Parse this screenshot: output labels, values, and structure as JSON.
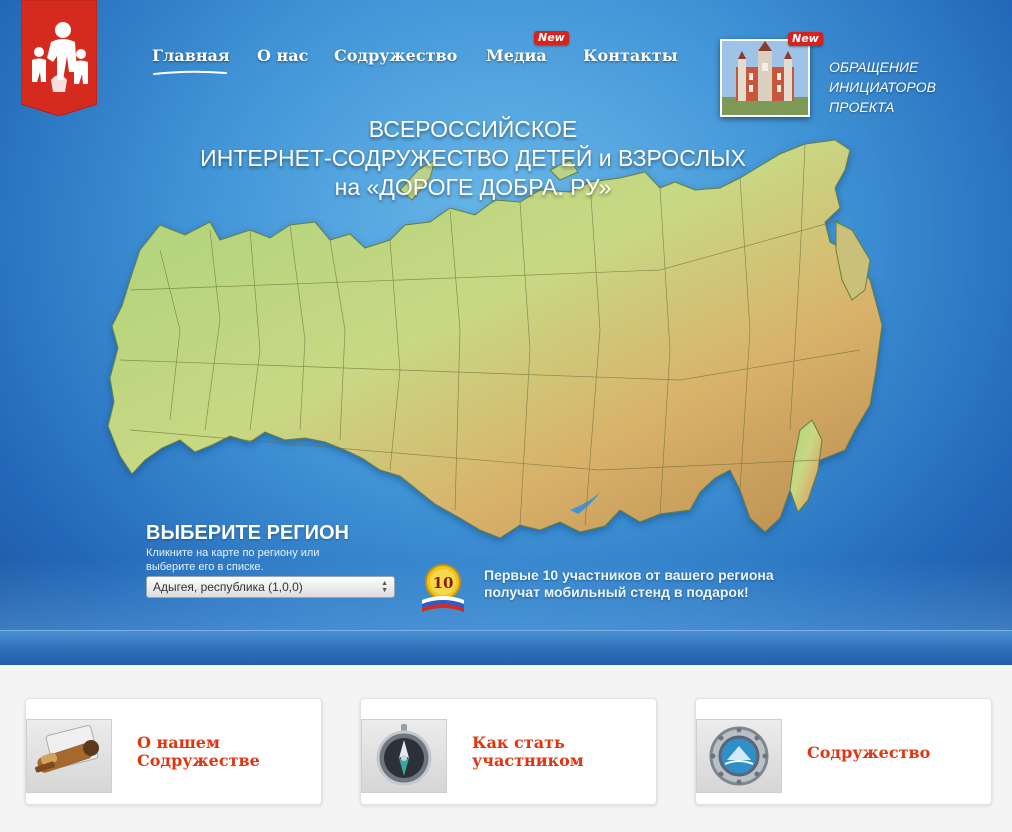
{
  "nav": {
    "items": [
      {
        "label": "Главная"
      },
      {
        "label": "О нас"
      },
      {
        "label": "Содружество"
      },
      {
        "label": "Медиа",
        "badge": "New"
      },
      {
        "label": "Контакты"
      }
    ]
  },
  "appeal": {
    "badge": "New",
    "text_line1": "ОБРАЩЕНИЕ",
    "text_line2": "ИНИЦИАТОРОВ",
    "text_line3": "ПРОЕКТА"
  },
  "hero": {
    "title_line1": "ВСЕРОССИЙСКОЕ",
    "title_line2": "ИНТЕРНЕТ-СОДРУЖЕСТВО ДЕТЕЙ и ВЗРОСЛЫХ",
    "title_line3": "на «ДОРОГЕ ДОБРА. РУ»"
  },
  "region": {
    "title": "ВЫБЕРИТЕ РЕГИОН",
    "hint": "Кликните на карте по региону или выберите его в списке.",
    "selected": "Адыгея, республика (1,0,0)"
  },
  "promo": {
    "badge_number": "10",
    "text_line1": "Первые 10 участников от вашего региона",
    "text_line2": "получат мобильный стенд в подарок!"
  },
  "cards": [
    {
      "line1": "О нашем",
      "line2": "Содружестве",
      "icon": "telescope-icon"
    },
    {
      "line1": "Как стать",
      "line2": "участником",
      "icon": "compass-icon"
    },
    {
      "line1": "Содружество",
      "line2": "",
      "icon": "porthole-icon"
    }
  ],
  "colors": {
    "accent_red": "#e2350f",
    "logo_red": "#d52b1e",
    "hero_blue": "#3f93d6"
  }
}
